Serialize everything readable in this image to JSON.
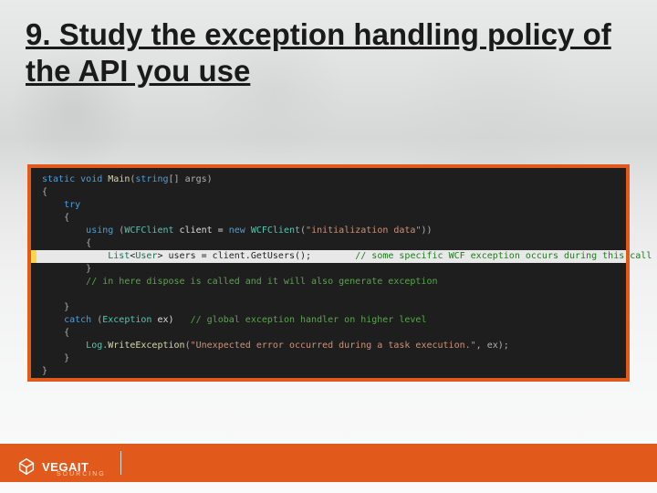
{
  "title": "9. Study the exception handling policy of the API you use",
  "code": {
    "l1": {
      "pre": "",
      "kw1": "static",
      "kw2": "void",
      "meth": "Main",
      "args_open": "(",
      "type": "string",
      "args_rest": "[] args)"
    },
    "l2": "{",
    "l3": {
      "kw": "try",
      "indent": "    "
    },
    "l4": {
      "text": "{",
      "indent": "    "
    },
    "l5": {
      "indent": "        ",
      "kw1": "using",
      "open": " (",
      "type1": "WCFClient",
      "id1": " client = ",
      "kw2": "new",
      "sp": " ",
      "type2": "WCFClient",
      "open2": "(",
      "str": "\"initialization data\"",
      "close": "))"
    },
    "l6": {
      "indent": "        ",
      "text": "{"
    },
    "l7": {
      "indent": "            ",
      "type1": "List",
      "lt": "<",
      "type2": "User",
      "gt": ">",
      "id": " users = client.",
      "meth": "GetUsers",
      "rest": "();        ",
      "cmt": "// some specific WCF exception occurs during this call"
    },
    "l8": {
      "indent": "        ",
      "text": "}"
    },
    "l9": {
      "indent": "        ",
      "cmt": "// in here dispose is called and it will also generate exception"
    },
    "blank": "",
    "l10": {
      "indent": "    ",
      "text": "}"
    },
    "l11": {
      "indent": "    ",
      "kw": "catch",
      "open": " (",
      "type": "Exception",
      "id": " ex)   ",
      "cmt": "// global exception handler on higher level"
    },
    "l12": {
      "indent": "    ",
      "text": "{"
    },
    "l13": {
      "indent": "        ",
      "type": "Log",
      "dot": ".",
      "meth": "WriteException",
      "open": "(",
      "str": "\"Unexpected error occurred during a task execution.\"",
      "rest": ", ex);"
    },
    "l14": {
      "indent": "    ",
      "text": "}"
    },
    "l15": "}"
  },
  "footer": {
    "logo_word1": "VEGAIT",
    "logo_word2": "SOURCING"
  }
}
